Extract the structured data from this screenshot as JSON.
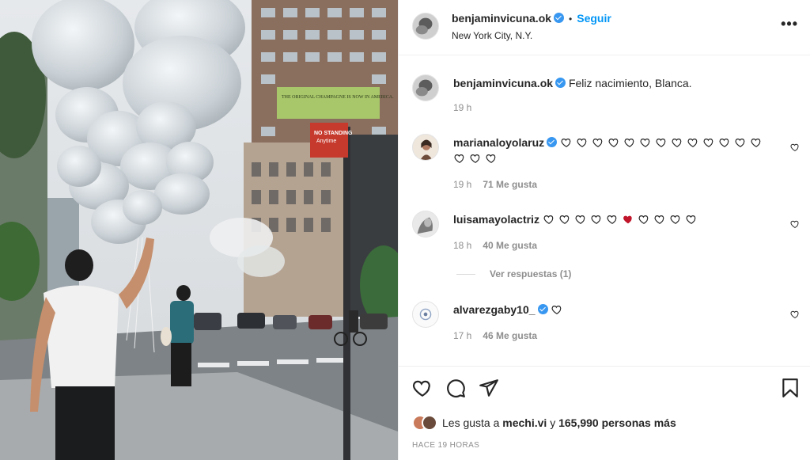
{
  "post": {
    "username": "benjaminvicuna.ok",
    "follow_label": "Seguir",
    "separator": "•",
    "location": "New York City, N.Y.",
    "more_label": "•••"
  },
  "caption": {
    "username": "benjaminvicuna.ok",
    "text": "Feliz nacimiento, Blanca.",
    "time": "19 h"
  },
  "comments": [
    {
      "username": "marianaloyolaruz",
      "verified": true,
      "hearts_line1": 13,
      "hearts_line2": 3,
      "time": "19 h",
      "likes": "71 Me gusta"
    },
    {
      "username": "luisamayolactriz",
      "verified": false,
      "hearts_before_red": 5,
      "hearts_after_red": 4,
      "time": "18 h",
      "likes": "40 Me gusta",
      "replies": "Ver respuestas (1)"
    },
    {
      "username": "alvarezgaby10_",
      "verified": true,
      "hearts": 1,
      "time": "17 h",
      "likes": "46 Me gusta"
    }
  ],
  "footer": {
    "likes_prefix": "Les gusta a",
    "likes_user": "mechi.vi",
    "likes_connector": "y",
    "likes_others": "165,990 personas más",
    "time_ago": "HACE 19 HORAS"
  },
  "photo": {
    "billboard_text": "THE ORIGINAL CHAMPAGNE IS NOW IN AMERICA.",
    "sign_text_1": "NO STANDING",
    "sign_text_2": "Anytime"
  },
  "colors": {
    "accent": "#0095f6",
    "verified": "#3897f0",
    "muted": "#8e8e8e",
    "red_heart": "#c0152a"
  }
}
